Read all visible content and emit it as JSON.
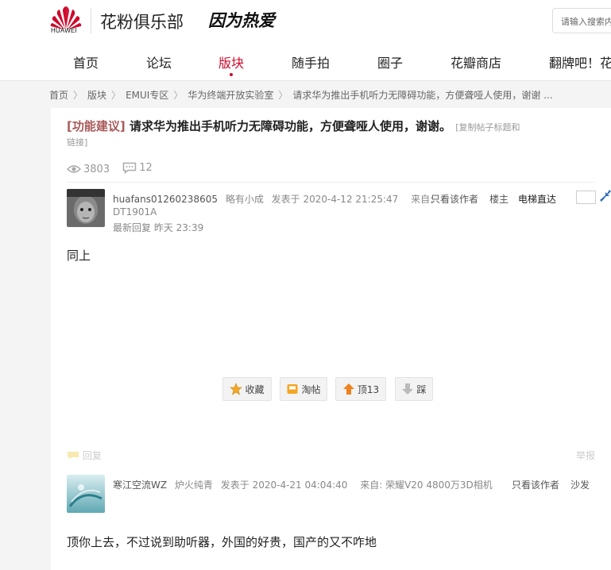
{
  "header": {
    "brand": "HUAWEI",
    "club_name": "花粉俱乐部",
    "slogan": "因为热爱",
    "search_placeholder": "请输入搜索内容"
  },
  "nav": [
    {
      "label": "首页"
    },
    {
      "label": "论坛"
    },
    {
      "label": "版块",
      "active": true
    },
    {
      "label": "随手拍"
    },
    {
      "label": "圈子"
    },
    {
      "label": "花瓣商店"
    },
    {
      "label": "翻牌吧！花"
    }
  ],
  "breadcrumb": [
    "首页",
    "版块",
    "EMUI专区",
    "华为终端开放实验室",
    "请求华为推出手机听力无障碍功能，方便聋哑人使用，谢谢 ..."
  ],
  "thread": {
    "tag": "[功能建议]",
    "title": "请求华为推出手机听力无障碍功能，方便聋哑人使用，谢谢。",
    "copy_link_a": "[复制帖子标题和",
    "copy_link_b": "链接]",
    "views": "3803",
    "replies": "12"
  },
  "posts": [
    {
      "user": "huafans01260238605",
      "rank": "略有小成",
      "posted": "发表于 2020-4-12 21:25:47",
      "from_label": "来自:",
      "device": "DT1901A",
      "last_reply": "最新回复 昨天 23:39",
      "only_author": "只看该作者",
      "floor": "楼主",
      "elevator": "电梯直达",
      "content": "同上"
    },
    {
      "user": "寒江空流WZ",
      "rank": "炉火纯青",
      "posted": "发表于 2020-4-21 04:04:40",
      "from": "来自: 荣耀V20 4800万3D相机",
      "only_author": "只看该作者",
      "floor": "沙发",
      "content": "顶你上去，不过说到助听器，外国的好贵，国产的又不咋地"
    }
  ],
  "actions": {
    "favorite": "收藏",
    "tao": "淘帖",
    "up": "顶13",
    "down": "踩"
  },
  "reply_bar": {
    "reply": "回复",
    "report": "举报"
  },
  "colors": {
    "accent": "#cf0a2c",
    "tag": "#aa5a5a"
  }
}
